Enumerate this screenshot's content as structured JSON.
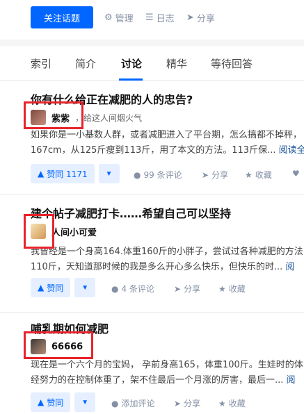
{
  "topbar": {
    "follow_label": "关注话题",
    "manage_label": "管理",
    "log_label": "日志",
    "share_label": "分享"
  },
  "tabs": [
    {
      "label": "索引"
    },
    {
      "label": "简介"
    },
    {
      "label": "讨论"
    },
    {
      "label": "精华"
    },
    {
      "label": "等待回答"
    }
  ],
  "active_tab": "讨论",
  "items": [
    {
      "title": "你有什么给正在减肥的人的忠告?",
      "author": "紫紫",
      "bio": "，给这人间烟火气",
      "excerpt_1": "如果你是一小基数人群，或者减肥进入了平台期，怎么搞都不掉秤，",
      "excerpt_2": "167cm，从125斤瘦到113斤，用了本文的方法。113斤保...",
      "read_more": "阅读全",
      "vote_label": "赞同 1171",
      "comments": "99 条评论",
      "share": "分享",
      "favorite": "收藏"
    },
    {
      "title": "建个帖子减肥打卡……希望自己可以坚持",
      "author": "人间小可爱",
      "excerpt_1": "我曾经是一个身高164.体重160斤的小胖子，尝试过各种减肥的方法",
      "excerpt_2": "110斤，天知道那时候的我是多么开心多么快乐，但快乐的时...",
      "read_more": "阅",
      "vote_label": "赞同",
      "comments": "4 条评论",
      "share": "分享",
      "favorite": "收藏"
    },
    {
      "title": "哺乳期如何减肥",
      "author": "66666",
      "excerpt_1": "现在是一个六个月的宝妈，  孕前身高165，体重100斤。生娃时的体",
      "excerpt_2": "经努力的在控制体重了，架不住最后一个月涨的厉害，最后一...",
      "read_more": "阅",
      "vote_label": "赞同",
      "comments": "添加评论",
      "share": "分享",
      "favorite": "收藏"
    }
  ],
  "colors": {
    "primary": "#0066ff",
    "highlight": "#e8232b"
  },
  "icons": [
    "gear-icon",
    "list-icon",
    "send-icon",
    "comment-icon",
    "star-icon",
    "heart-icon",
    "caret-up-icon",
    "caret-down-icon"
  ]
}
